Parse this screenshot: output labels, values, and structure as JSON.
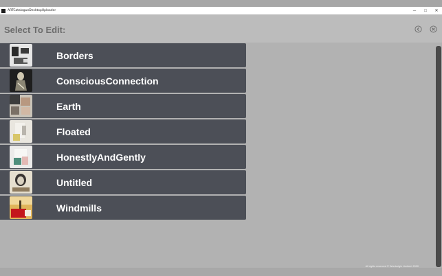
{
  "window": {
    "title": "ARTCatalogueDesktopUploader",
    "controls": {
      "minimize": "─",
      "maximize": "□",
      "close": "✕"
    }
  },
  "header": {
    "title": "Select To Edit:",
    "icons": [
      "back-circle-icon",
      "close-circle-icon"
    ]
  },
  "items": [
    {
      "label": "Borders",
      "thumb": "artwork-thumbnail-borders"
    },
    {
      "label": "ConsciousConnection",
      "thumb": "artwork-thumbnail-consciousconnection"
    },
    {
      "label": "Earth",
      "thumb": "artwork-thumbnail-earth"
    },
    {
      "label": "Floated",
      "thumb": "artwork-thumbnail-floated"
    },
    {
      "label": "HonestlyAndGently",
      "thumb": "artwork-thumbnail-honestlyandgently"
    },
    {
      "label": "Untitled",
      "thumb": "artwork-thumbnail-untitled"
    },
    {
      "label": "Windmills",
      "thumb": "artwork-thumbnail-windmills"
    }
  ],
  "footer": {
    "copyright": "All rights reserved © Wordorigin Limited. 2020"
  },
  "colors": {
    "list_item_bg": "#4c4f57",
    "page_bg": "#bcbcbc",
    "content_bg": "#b2b2b2",
    "label": "#ffffff",
    "title": "#6c6c6c"
  }
}
